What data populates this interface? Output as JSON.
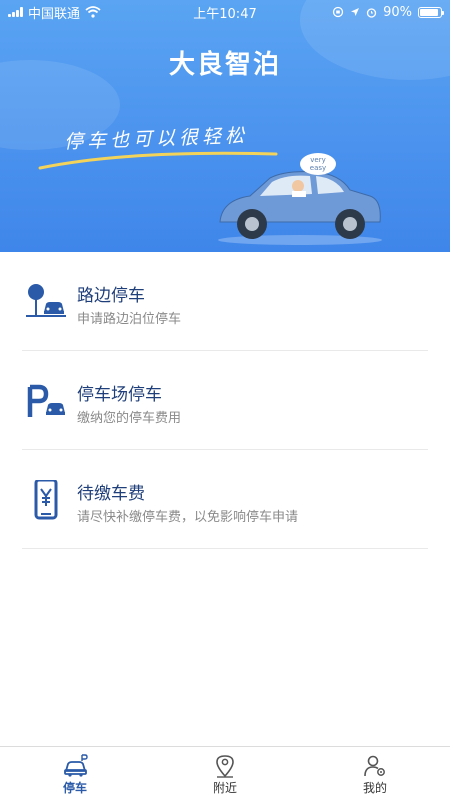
{
  "status_bar": {
    "carrier": "中国联通",
    "time": "上午10:47",
    "battery": "90%",
    "battery_level": 0.9
  },
  "hero": {
    "app_title": "大良智泊",
    "slogan": "停车也可以很轻松",
    "bubble_text_1": "very",
    "bubble_text_2": "easy"
  },
  "menu": {
    "items": [
      {
        "title": "路边停车",
        "subtitle": "申请路边泊位停车",
        "icon": "roadside-parking-icon"
      },
      {
        "title": "停车场停车",
        "subtitle": "缴纳您的停车费用",
        "icon": "parking-lot-icon"
      },
      {
        "title": "待缴车费",
        "subtitle": "请尽快补缴停车费，以免影响停车申请",
        "icon": "phone-payment-icon"
      }
    ]
  },
  "tabbar": {
    "tabs": [
      {
        "label": "停车",
        "icon": "car-icon",
        "active": true
      },
      {
        "label": "附近",
        "icon": "location-pin-icon",
        "active": false
      },
      {
        "label": "我的",
        "icon": "user-settings-icon",
        "active": false
      }
    ]
  },
  "colors": {
    "hero_blue": "#4b93ee",
    "accent_navy": "#1f3f7a",
    "icon_blue": "#2a5aa8",
    "swoosh_yellow": "#f3d35a",
    "car_blue": "#6f9ad8"
  }
}
